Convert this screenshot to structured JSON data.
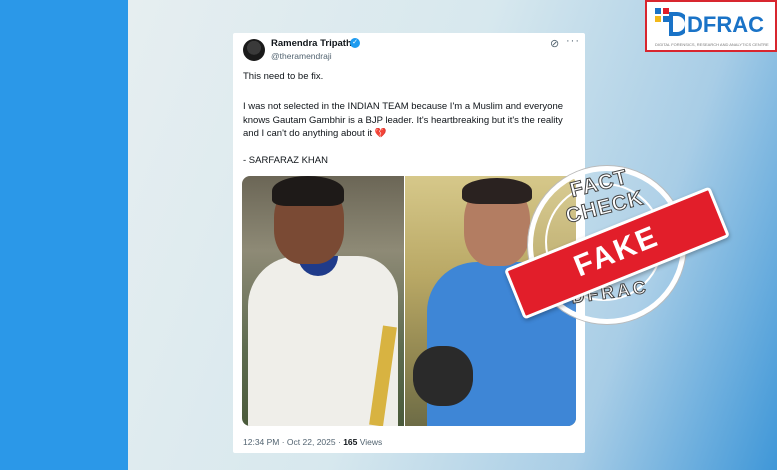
{
  "brand": {
    "logo_text": "DFRAC",
    "logo_sub": "DIGITAL FORENSICS, RESEARCH AND ANALYTICS CENTRE"
  },
  "tweet": {
    "author": "Ramendra Tripathi",
    "handle": "@theramendraji",
    "para1": "This need to be fix.",
    "para2": "I was not selected in the INDIAN TEAM because I'm a Muslim and everyone knows Gautam Gambhir is a BJP leader. It's heartbreaking but it's the reality and I can't do anything about it 💔",
    "para3": "- SARFARAZ KHAN",
    "time": "12:34 PM · Oct 22, 2025 ·",
    "views_count": "165",
    "views_label": " Views"
  },
  "stamp": {
    "top": "FACT CHECK",
    "bottom": "DFRAC",
    "label": "FAKE"
  },
  "icons": {
    "verified": "verified-badge-icon",
    "grok": "grok-icon",
    "more": "more-icon"
  },
  "colors": {
    "stamp_red": "#e21e2a",
    "twitter_blue": "#1d9bf0",
    "brand_blue": "#1a73c7"
  }
}
